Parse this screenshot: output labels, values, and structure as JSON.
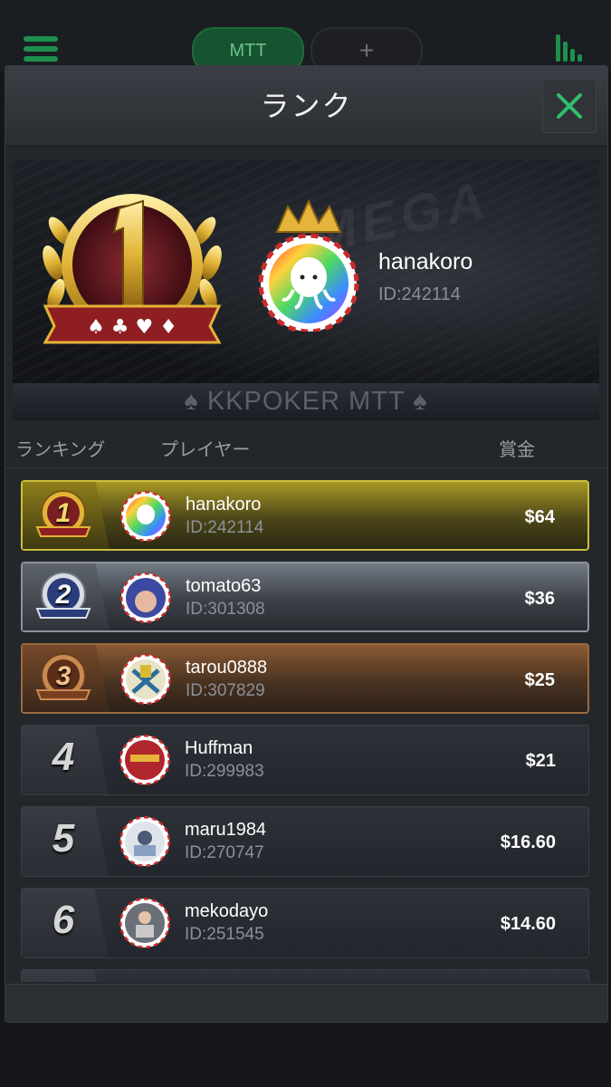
{
  "topbar": {
    "tab_mtt": "MTT",
    "tab_add": "+",
    "menu_icon": "hamburger-menu-icon",
    "stats_icon": "bar-stats-icon",
    "accent_color": "#1f8f4d"
  },
  "modal": {
    "title": "ランク",
    "close_icon": "close-x-icon",
    "close_color": "#2fbf6a"
  },
  "banner": {
    "winner_name": "hanakoro",
    "winner_id": "ID:242114",
    "strip_text": "♠ KKPOKER MTT ♠",
    "trophy_number": "1"
  },
  "columns": {
    "rank": "ランキング",
    "player": "プレイヤー",
    "prize": "賞金"
  },
  "players": [
    {
      "rank": "1",
      "name": "hanakoro",
      "id": "ID:242114",
      "prize": "$64"
    },
    {
      "rank": "2",
      "name": "tomato63",
      "id": "ID:301308",
      "prize": "$36"
    },
    {
      "rank": "3",
      "name": "tarou0888",
      "id": "ID:307829",
      "prize": "$25"
    },
    {
      "rank": "4",
      "name": "Huffman",
      "id": "ID:299983",
      "prize": "$21"
    },
    {
      "rank": "5",
      "name": "maru1984",
      "id": "ID:270747",
      "prize": "$16.60"
    },
    {
      "rank": "6",
      "name": "mekodayo",
      "id": "ID:251545",
      "prize": "$14.60"
    }
  ]
}
